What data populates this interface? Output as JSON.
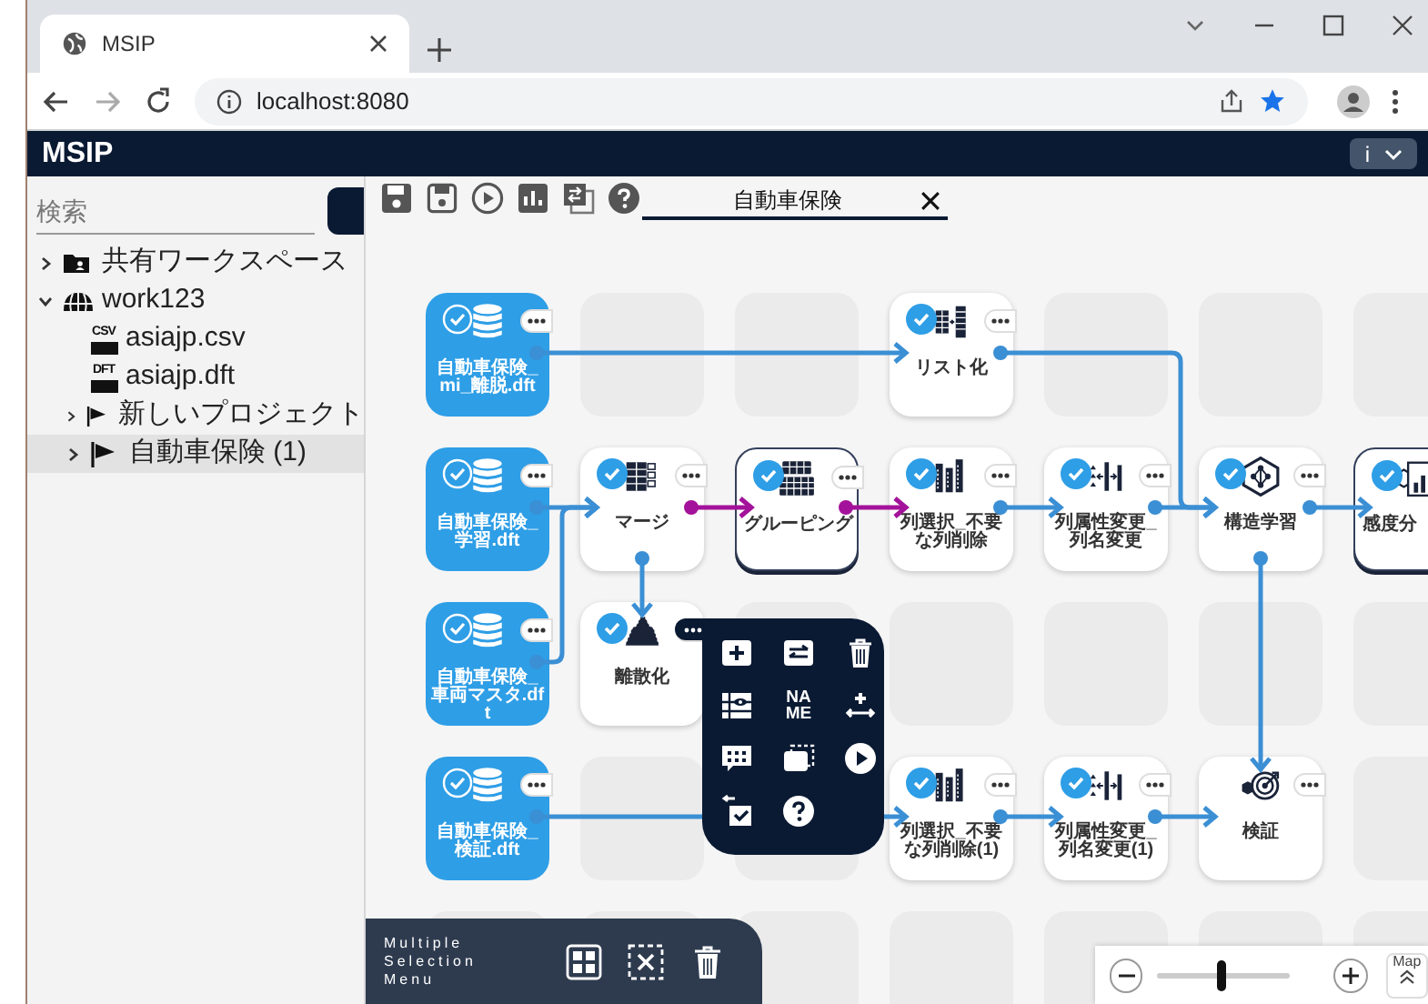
{
  "browser": {
    "tab_title": "MSIP",
    "url": "localhost:8080"
  },
  "app": {
    "title": "MSIP",
    "info_button": "i"
  },
  "sidebar": {
    "search": {
      "placeholder": "検索"
    },
    "tree": [
      {
        "label": "共有ワークスペース",
        "kind": "shared",
        "expanded": false,
        "selected": false
      },
      {
        "label": "work123",
        "kind": "workspace",
        "expanded": true,
        "selected": false,
        "children": [
          {
            "label": "asiajp.csv",
            "kind": "file",
            "badge": "CSV",
            "selected": false
          },
          {
            "label": "asiajp.dft",
            "kind": "file",
            "badge": "DFT",
            "selected": false
          },
          {
            "label": "新しいプロジェクト",
            "kind": "project",
            "expanded": false,
            "selected": false
          },
          {
            "label": "自動車保険 (1)",
            "kind": "project",
            "expanded": false,
            "selected": true
          }
        ]
      }
    ]
  },
  "toolbar": {
    "buttons": [
      {
        "kind": "save"
      },
      {
        "kind": "save-as"
      },
      {
        "kind": "run"
      },
      {
        "kind": "chart"
      },
      {
        "kind": "copy"
      },
      {
        "kind": "help"
      }
    ]
  },
  "document_tab": {
    "title": "自動車保険"
  },
  "flow": {
    "rows": [
      [
        {
          "kind": "dataset",
          "label": "自動車保険_mi_離脱.dft",
          "checked": true,
          "selected": false,
          "links": [
            {
              "kind": "right",
              "color": "#3b8fd4"
            }
          ]
        },
        null,
        null,
        {
          "kind": "list",
          "label": "リスト化",
          "checked": true,
          "selected": false,
          "links": [
            {
              "kind": "down-right",
              "color": "#3b8fd4"
            }
          ]
        },
        null,
        null,
        null
      ],
      [
        {
          "kind": "dataset",
          "label": "自動車保険_学習.dft",
          "checked": true,
          "selected": false,
          "links": [
            {
              "kind": "right",
              "color": "#3b8fd4"
            }
          ]
        },
        {
          "kind": "merge",
          "label": "マージ",
          "checked": true,
          "selected": false,
          "links": [
            {
              "kind": "right",
              "color": "#a3129a"
            },
            {
              "kind": "down",
              "color": "#3b8fd4"
            }
          ]
        },
        {
          "kind": "group",
          "label": "グルーピング",
          "checked": true,
          "selected": true,
          "links": [
            {
              "kind": "right",
              "color": "#a3129a"
            }
          ]
        },
        {
          "kind": "columns",
          "label": "列選択_不要な列削除",
          "checked": true,
          "selected": false,
          "links": [
            {
              "kind": "right",
              "color": "#3b8fd4"
            }
          ]
        },
        {
          "kind": "attribute",
          "label": "列属性変更_列名変更",
          "checked": true,
          "selected": false,
          "links": [
            {
              "kind": "right",
              "color": "#3b8fd4"
            }
          ]
        },
        {
          "kind": "structure",
          "label": "構造学習",
          "checked": true,
          "selected": false,
          "links": [
            {
              "kind": "right",
              "color": "#3b8fd4"
            },
            {
              "kind": "down",
              "color": "#3b8fd4"
            }
          ]
        },
        {
          "kind": "sensitivity",
          "label": "感度分",
          "checked": true,
          "selected": true
        }
      ],
      [
        {
          "kind": "dataset",
          "label": "自動車保険_車両マスタ.dft",
          "checked": true,
          "selected": false,
          "links": [
            {
              "kind": "up-right",
              "color": "#3b8fd4"
            }
          ]
        },
        {
          "kind": "discretize",
          "label": "離散化",
          "checked": true,
          "selected": false
        },
        null,
        null,
        null,
        null,
        null
      ],
      [
        {
          "kind": "dataset",
          "label": "自動車保険_検証.dft",
          "checked": true,
          "selected": false,
          "links": [
            {
              "kind": "right",
              "color": "#3b8fd4"
            }
          ]
        },
        null,
        null,
        {
          "kind": "columns",
          "label": "列選択_不要な列削除(1)",
          "checked": true,
          "selected": false,
          "links": [
            {
              "kind": "right",
              "color": "#3b8fd4"
            }
          ]
        },
        {
          "kind": "attribute",
          "label": "列属性変更_列名変更(1)",
          "checked": true,
          "selected": false,
          "links": [
            {
              "kind": "right",
              "color": "#3b8fd4"
            }
          ]
        },
        {
          "kind": "validate",
          "label": "検証",
          "checked": false,
          "selected": false
        },
        null
      ],
      [
        null,
        null,
        null,
        null,
        null,
        null,
        null
      ]
    ]
  },
  "context_menu": {
    "items": [
      {
        "kind": "add"
      },
      {
        "kind": "swap"
      },
      {
        "kind": "delete"
      },
      {
        "kind": "preview"
      },
      {
        "kind": "name",
        "label": "NAME"
      },
      {
        "kind": "insert"
      },
      {
        "kind": "comment"
      },
      {
        "kind": "frame"
      },
      {
        "kind": "run"
      },
      {
        "kind": "replace"
      },
      {
        "kind": "help"
      }
    ]
  },
  "selection_menu": {
    "title": "Multiple Selection Menu",
    "buttons": [
      {
        "kind": "select-all"
      },
      {
        "kind": "deselect"
      },
      {
        "kind": "delete"
      }
    ]
  },
  "zoom": {
    "level": 0.45,
    "map_label": "Map"
  }
}
